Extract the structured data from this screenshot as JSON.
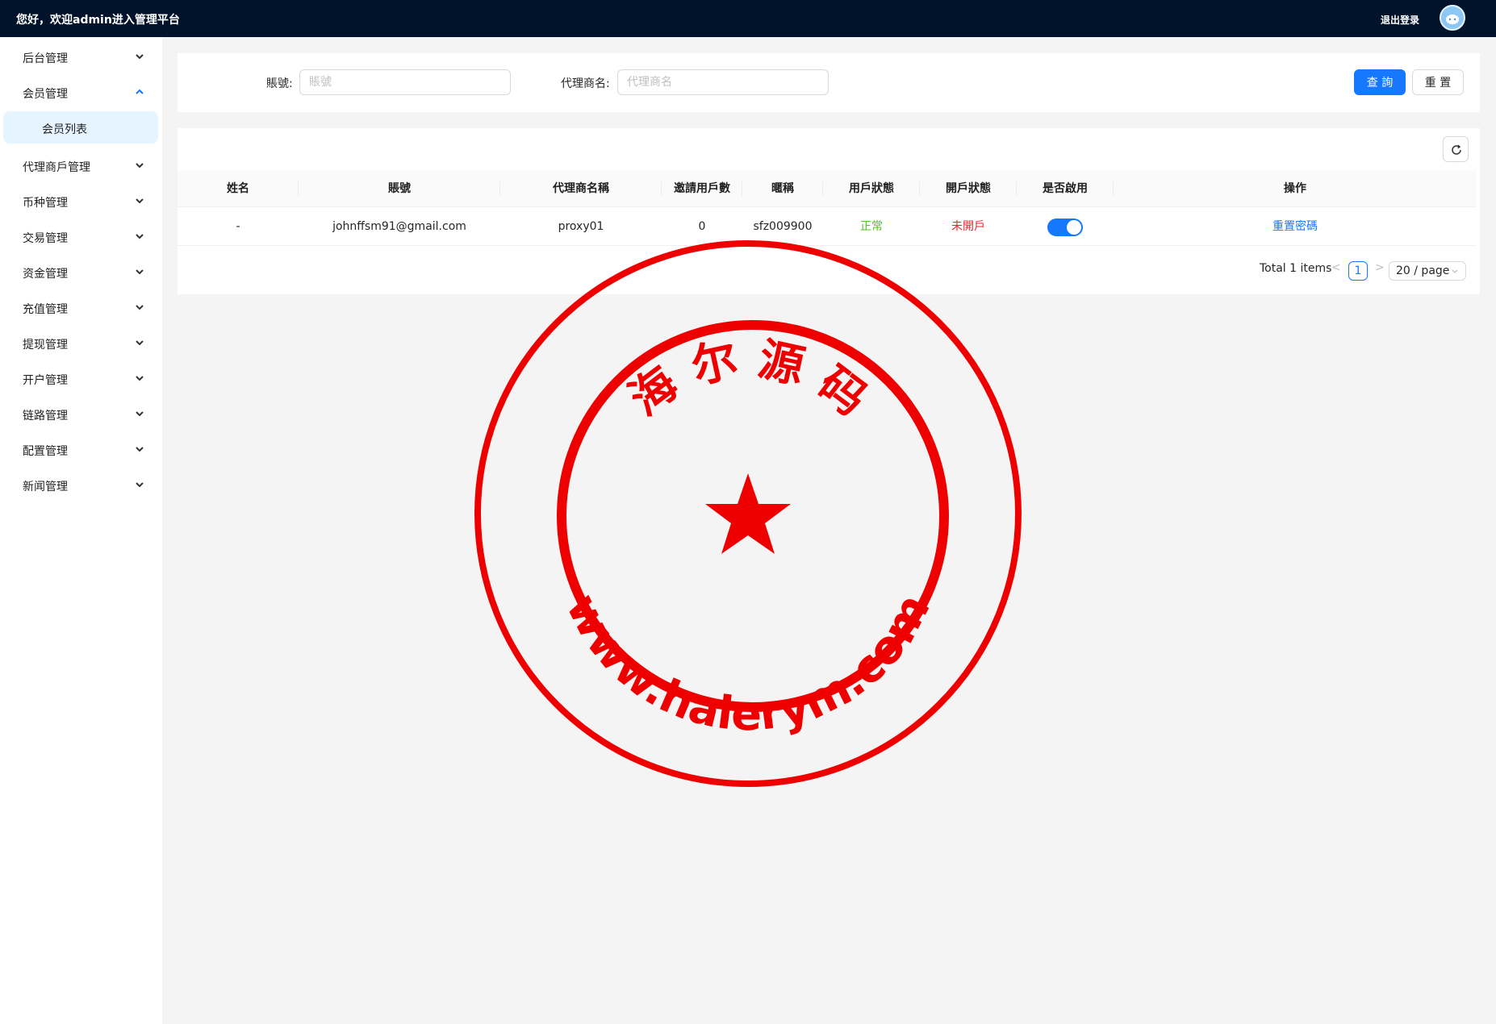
{
  "header": {
    "welcome": "您好，欢迎admin进入管理平台",
    "logout": "退出登录",
    "avatar_icon": "avatar-icon"
  },
  "sidebar": {
    "items": [
      {
        "label": "后台管理",
        "expanded": false
      },
      {
        "label": "会员管理",
        "expanded": true
      },
      {
        "label": "代理商戶管理",
        "expanded": false
      },
      {
        "label": "币种管理",
        "expanded": false
      },
      {
        "label": "交易管理",
        "expanded": false
      },
      {
        "label": "资金管理",
        "expanded": false
      },
      {
        "label": "充值管理",
        "expanded": false
      },
      {
        "label": "提现管理",
        "expanded": false
      },
      {
        "label": "开户管理",
        "expanded": false
      },
      {
        "label": "链路管理",
        "expanded": false
      },
      {
        "label": "配置管理",
        "expanded": false
      },
      {
        "label": "新闻管理",
        "expanded": false
      }
    ],
    "subitem": "会员列表"
  },
  "search": {
    "account_label": "賬號:",
    "account_placeholder": "賬號",
    "account_value": "",
    "agent_label": "代理商名:",
    "agent_placeholder": "代理商名",
    "agent_value": "",
    "query_button": "查 詢",
    "reset_button": "重 置"
  },
  "table": {
    "columns": [
      "姓名",
      "賬號",
      "代理商名稱",
      "邀請用戶數",
      "暱稱",
      "用戶狀態",
      "開戶狀態",
      "是否啟用",
      "操作"
    ],
    "rows": [
      {
        "name": "-",
        "account": "johnffsm91@gmail.com",
        "agent": "proxy01",
        "invites": "0",
        "nickname": "sfz009900",
        "user_status": "正常",
        "open_status": "未開戶",
        "enabled": true,
        "action": "重置密碼"
      }
    ]
  },
  "pagination": {
    "total": "Total 1 items",
    "current_page": "1",
    "page_size": "20 / page"
  },
  "colors": {
    "primary": "#1677ff",
    "header_bg": "#00132b",
    "success": "#52c41a",
    "danger": "#f5222d",
    "seal_red": "#ee0000"
  },
  "watermark": {
    "top_text": "海 尔 源 码",
    "bottom_text": "www.haierym.com"
  }
}
